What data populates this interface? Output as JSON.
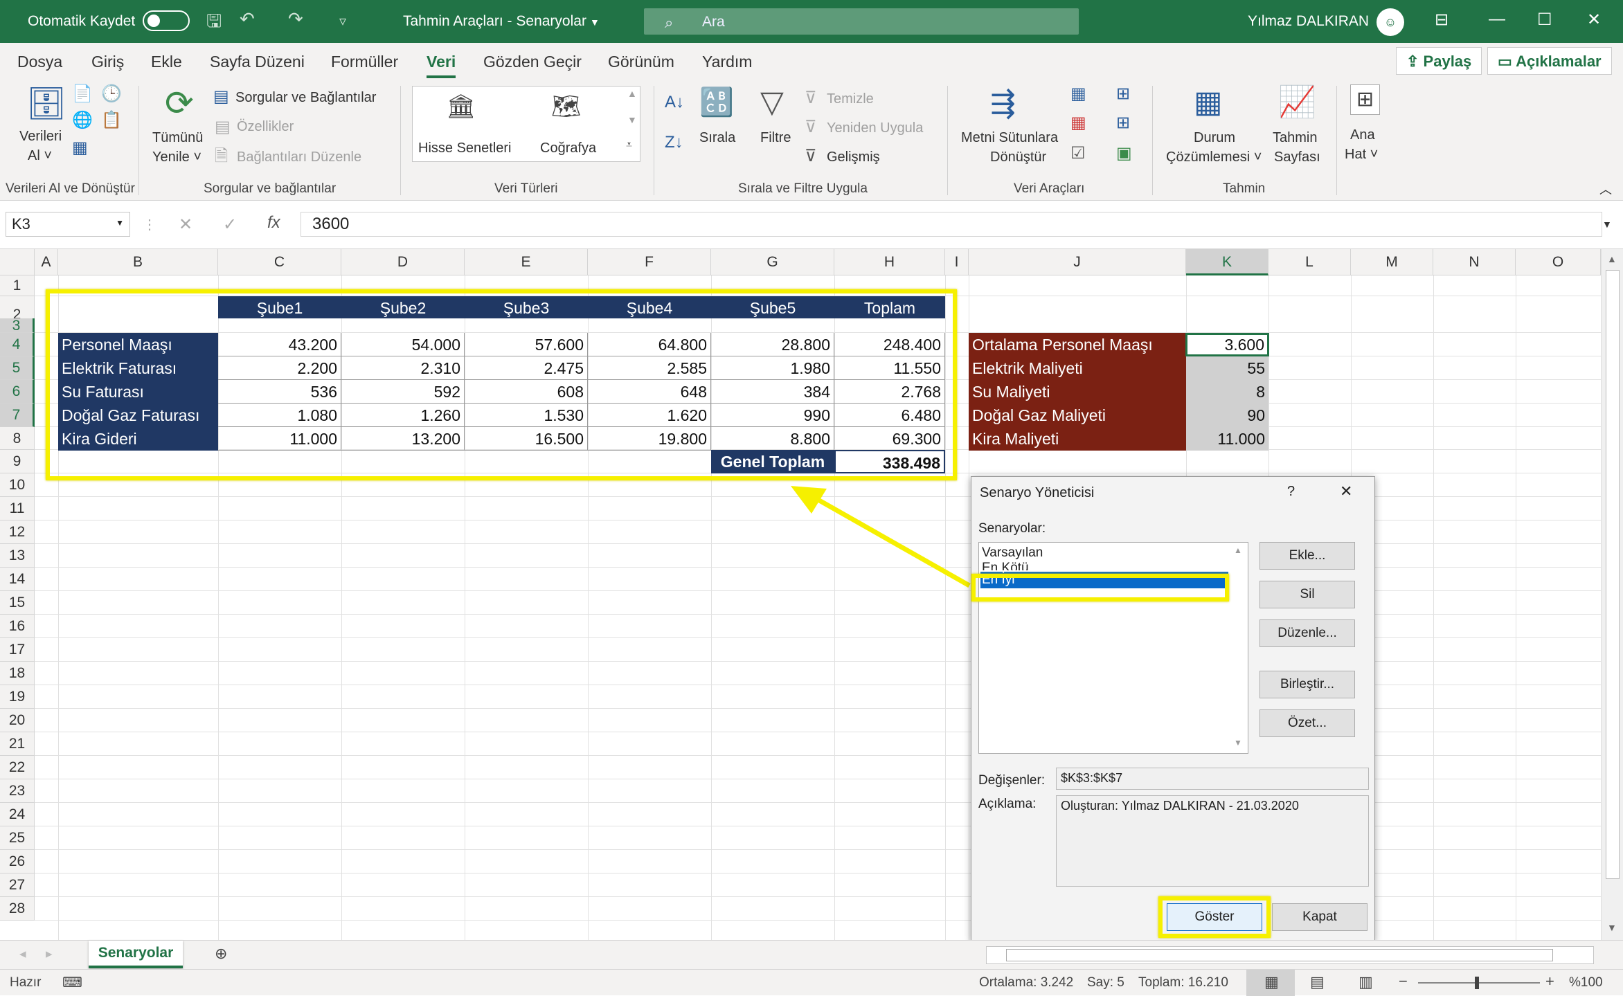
{
  "titlebar": {
    "autosave": "Otomatik Kaydet",
    "title": "Tahmin Araçları - Senaryolar",
    "search_placeholder": "Ara",
    "user": "Yılmaz DALKIRAN"
  },
  "menu": {
    "items": [
      "Dosya",
      "Giriş",
      "Ekle",
      "Sayfa Düzeni",
      "Formüller",
      "Veri",
      "Gözden Geçir",
      "Görünüm",
      "Yardım"
    ],
    "active": "Veri",
    "share": "Paylaş",
    "comments": "Açıklamalar"
  },
  "ribbon": {
    "get_data": {
      "btn1": "Verileri",
      "btn2": "Al ˅",
      "group": "Verileri Al ve Dönüştür"
    },
    "queries": {
      "refresh1": "Tümünü",
      "refresh2": "Yenile ˅",
      "queries_conn": "Sorgular ve Bağlantılar",
      "properties": "Özellikler",
      "edit_links": "Bağlantıları Düzenle",
      "group": "Sorgular ve bağlantılar"
    },
    "data_types": {
      "stocks": "Hisse Senetleri",
      "geography": "Coğrafya",
      "group": "Veri Türleri"
    },
    "sort_filter": {
      "sort": "Sırala",
      "filter": "Filtre",
      "clear": "Temizle",
      "reapply": "Yeniden Uygula",
      "advanced": "Gelişmiş",
      "group": "Sırala ve Filtre Uygula"
    },
    "data_tools": {
      "ttc1": "Metni Sütunlara",
      "ttc2": "Dönüştür",
      "group": "Veri Araçları"
    },
    "forecast": {
      "whatif1": "Durum",
      "whatif2": "Çözümlemesi ˅",
      "sheet1": "Tahmin",
      "sheet2": "Sayfası",
      "group": "Tahmin"
    },
    "outline": {
      "l1": "Ana",
      "l2": "Hat ˅"
    }
  },
  "formula_bar": {
    "namebox": "K3",
    "value": "3600"
  },
  "columns": [
    "A",
    "B",
    "C",
    "D",
    "E",
    "F",
    "G",
    "H",
    "I",
    "J",
    "K",
    "L",
    "M",
    "N",
    "O"
  ],
  "rows": [
    "1",
    "2",
    "3",
    "4",
    "5",
    "6",
    "7",
    "8",
    "9",
    "10",
    "11",
    "12",
    "13",
    "14",
    "15",
    "16",
    "17",
    "18",
    "19",
    "20",
    "21",
    "22",
    "23",
    "24",
    "25",
    "26",
    "27",
    "28"
  ],
  "table": {
    "headers": [
      "Şube1",
      "Şube2",
      "Şube3",
      "Şube4",
      "Şube5",
      "Toplam"
    ],
    "rows": [
      {
        "label": "Personel Maaşı",
        "values": [
          "43.200",
          "54.000",
          "57.600",
          "64.800",
          "28.800",
          "248.400"
        ]
      },
      {
        "label": "Elektrik Faturası",
        "values": [
          "2.200",
          "2.310",
          "2.475",
          "2.585",
          "1.980",
          "11.550"
        ]
      },
      {
        "label": "Su Faturası",
        "values": [
          "536",
          "592",
          "608",
          "648",
          "384",
          "2.768"
        ]
      },
      {
        "label": "Doğal Gaz Faturası",
        "values": [
          "1.080",
          "1.260",
          "1.530",
          "1.620",
          "990",
          "6.480"
        ]
      },
      {
        "label": "Kira Gideri",
        "values": [
          "11.000",
          "13.200",
          "16.500",
          "19.800",
          "8.800",
          "69.300"
        ]
      }
    ],
    "grand_total_label": "Genel Toplam",
    "grand_total_value": "338.498"
  },
  "inputs": [
    {
      "label": "Ortalama Personel Maaşı",
      "value": "3.600"
    },
    {
      "label": "Elektrik Maliyeti",
      "value": "55"
    },
    {
      "label": "Su Maliyeti",
      "value": "8"
    },
    {
      "label": "Doğal Gaz Maliyeti",
      "value": "90"
    },
    {
      "label": "Kira Maliyeti",
      "value": "11.000"
    }
  ],
  "dialog": {
    "title": "Senaryo Yöneticisi",
    "help": "?",
    "close": "✕",
    "scenarios_label": "Senaryolar:",
    "scenarios": [
      "Varsayılan",
      "En Kötü",
      "En İyi"
    ],
    "selected": "En İyi",
    "buttons": [
      "Ekle...",
      "Sil",
      "Düzenle...",
      "Birleştir...",
      "Özet..."
    ],
    "changing_label": "Değişenler:",
    "changing_value": "$K$3:$K$7",
    "comment_label": "Açıklama:",
    "comment_value": "Oluşturan: Yılmaz DALKIRAN - 21.03.2020",
    "show": "Göster",
    "close_btn": "Kapat"
  },
  "sheet_tab": "Senaryolar",
  "status": {
    "ready": "Hazır",
    "average": "Ortalama: 3.242",
    "count": "Say: 5",
    "sum": "Toplam: 16.210",
    "zoom": "%100"
  },
  "colors": {
    "excel_green": "#217346",
    "header_navy": "#203864",
    "input_red": "#7b2113",
    "highlight_yellow": "#f6f000",
    "list_selection": "#0a6ac8"
  }
}
